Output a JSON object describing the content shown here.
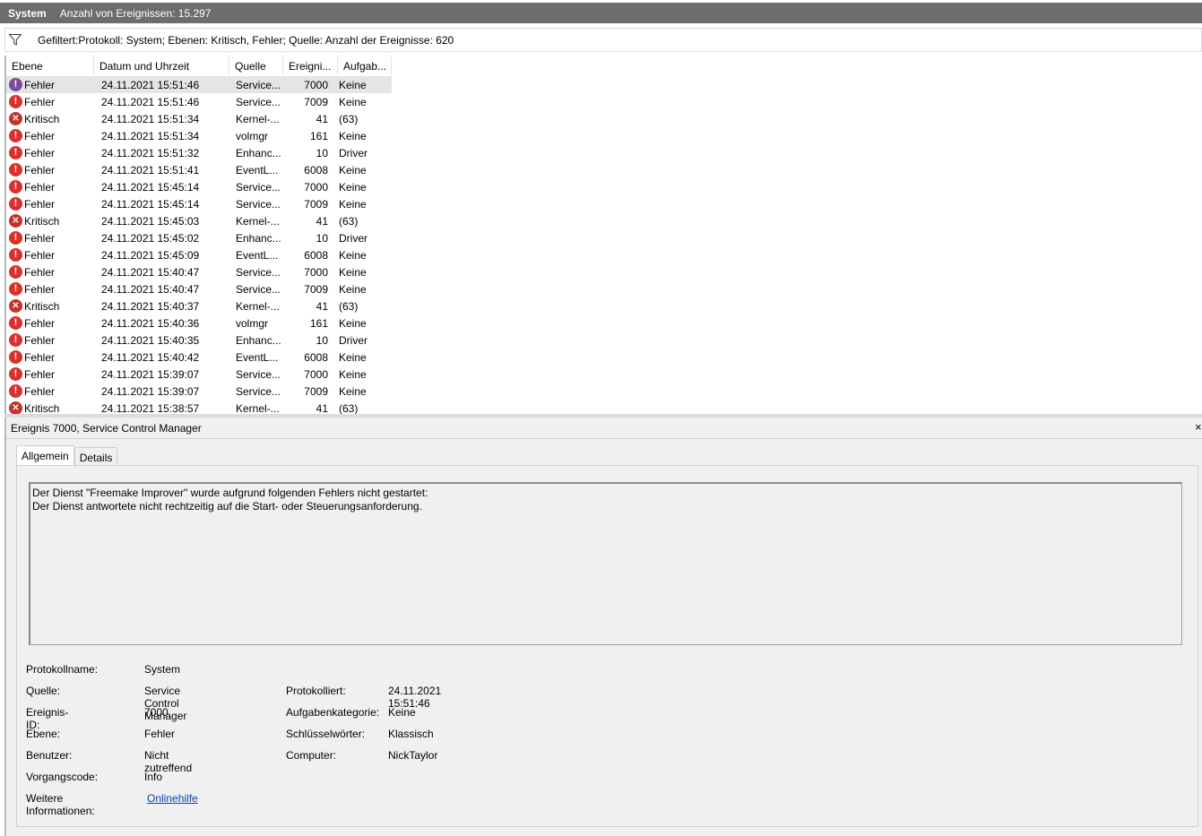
{
  "window": {
    "title": "System",
    "event_count": "Anzahl von Ereignissen: 15.297"
  },
  "filter": {
    "text": "Gefiltert:Protokoll: System; Ebenen: Kritisch, Fehler; Quelle:  Anzahl der Ereignisse: 620"
  },
  "list": {
    "columns": [
      "Ebene",
      "Datum und Uhrzeit",
      "Quelle",
      "Ereigni...",
      "Aufgab..."
    ],
    "rows": [
      {
        "level": "Fehler",
        "type": "err",
        "datetime": "24.11.2021 15:51:46",
        "source": "Service...",
        "id": "7000",
        "task": "Keine",
        "selected": true
      },
      {
        "level": "Fehler",
        "type": "err",
        "datetime": "24.11.2021 15:51:46",
        "source": "Service...",
        "id": "7009",
        "task": "Keine"
      },
      {
        "level": "Kritisch",
        "type": "crit",
        "datetime": "24.11.2021 15:51:34",
        "source": "Kernel-...",
        "id": "41",
        "task": "(63)"
      },
      {
        "level": "Fehler",
        "type": "err",
        "datetime": "24.11.2021 15:51:34",
        "source": "volmgr",
        "id": "161",
        "task": "Keine"
      },
      {
        "level": "Fehler",
        "type": "err",
        "datetime": "24.11.2021 15:51:32",
        "source": "Enhanc...",
        "id": "10",
        "task": "Driver"
      },
      {
        "level": "Fehler",
        "type": "err",
        "datetime": "24.11.2021 15:51:41",
        "source": "EventL...",
        "id": "6008",
        "task": "Keine"
      },
      {
        "level": "Fehler",
        "type": "err",
        "datetime": "24.11.2021 15:45:14",
        "source": "Service...",
        "id": "7000",
        "task": "Keine"
      },
      {
        "level": "Fehler",
        "type": "err",
        "datetime": "24.11.2021 15:45:14",
        "source": "Service...",
        "id": "7009",
        "task": "Keine"
      },
      {
        "level": "Kritisch",
        "type": "crit",
        "datetime": "24.11.2021 15:45:03",
        "source": "Kernel-...",
        "id": "41",
        "task": "(63)"
      },
      {
        "level": "Fehler",
        "type": "err",
        "datetime": "24.11.2021 15:45:02",
        "source": "Enhanc...",
        "id": "10",
        "task": "Driver"
      },
      {
        "level": "Fehler",
        "type": "err",
        "datetime": "24.11.2021 15:45:09",
        "source": "EventL...",
        "id": "6008",
        "task": "Keine"
      },
      {
        "level": "Fehler",
        "type": "err",
        "datetime": "24.11.2021 15:40:47",
        "source": "Service...",
        "id": "7000",
        "task": "Keine"
      },
      {
        "level": "Fehler",
        "type": "err",
        "datetime": "24.11.2021 15:40:47",
        "source": "Service...",
        "id": "7009",
        "task": "Keine"
      },
      {
        "level": "Kritisch",
        "type": "crit",
        "datetime": "24.11.2021 15:40:37",
        "source": "Kernel-...",
        "id": "41",
        "task": "(63)"
      },
      {
        "level": "Fehler",
        "type": "err",
        "datetime": "24.11.2021 15:40:36",
        "source": "volmgr",
        "id": "161",
        "task": "Keine"
      },
      {
        "level": "Fehler",
        "type": "err",
        "datetime": "24.11.2021 15:40:35",
        "source": "Enhanc...",
        "id": "10",
        "task": "Driver"
      },
      {
        "level": "Fehler",
        "type": "err",
        "datetime": "24.11.2021 15:40:42",
        "source": "EventL...",
        "id": "6008",
        "task": "Keine"
      },
      {
        "level": "Fehler",
        "type": "err",
        "datetime": "24.11.2021 15:39:07",
        "source": "Service...",
        "id": "7000",
        "task": "Keine"
      },
      {
        "level": "Fehler",
        "type": "err",
        "datetime": "24.11.2021 15:39:07",
        "source": "Service...",
        "id": "7009",
        "task": "Keine"
      },
      {
        "level": "Kritisch",
        "type": "crit",
        "datetime": "24.11.2021 15:38:57",
        "source": "Kernel-...",
        "id": "41",
        "task": "(63)"
      }
    ]
  },
  "detail": {
    "title": "Ereignis 7000, Service Control Manager",
    "tabs": [
      "Allgemein",
      "Details"
    ],
    "description": "Der Dienst \"Freemake Improver\" wurde aufgrund folgenden Fehlers nicht gestartet:\nDer Dienst antwortete nicht rechtzeitig auf die Start- oder Steuerungsanforderung.",
    "props": {
      "log_name_label": "Protokollname:",
      "log_name": "System",
      "source_label": "Quelle:",
      "source": "Service Control Manager",
      "logged_label": "Protokolliert:",
      "logged": "24.11.2021 15:51:46",
      "event_id_label": "Ereignis-ID:",
      "event_id": "7000",
      "task_cat_label": "Aufgabenkategorie:",
      "task_cat": "Keine",
      "level_label": "Ebene:",
      "level": "Fehler",
      "keywords_label": "Schlüsselwörter:",
      "keywords": "Klassisch",
      "user_label": "Benutzer:",
      "user": "Nicht zutreffend",
      "computer_label": "Computer:",
      "computer": "NickTaylor",
      "opcode_label": "Vorgangscode:",
      "opcode": "Info",
      "more_info_label": "Weitere Informationen:",
      "more_info_link": "Onlinehilfe"
    }
  },
  "icons": {
    "error": "error-icon",
    "critical": "critical-icon",
    "filter": "filter-icon",
    "close": "close-icon"
  },
  "colors": {
    "titlebar": "#6d6d6d",
    "error": "#d9302c",
    "selected_row": "#e5e5e5",
    "link": "#0645ad"
  }
}
